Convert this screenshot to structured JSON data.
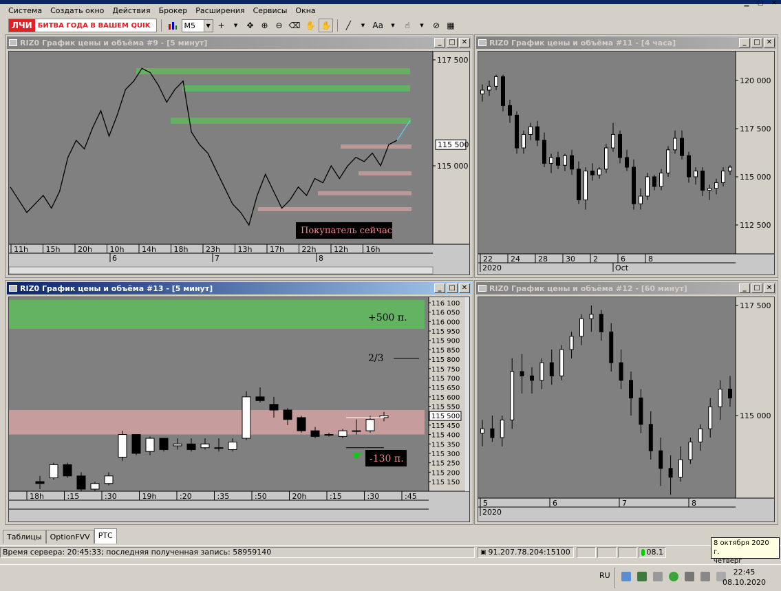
{
  "menu": {
    "items": [
      "Система",
      "Создать окно",
      "Действия",
      "Брокер",
      "Расширения",
      "Сервисы",
      "Окна"
    ]
  },
  "toolbar": {
    "logo_mark": "ЛЧИ",
    "logo_text": "БИТВА ГОДА В ВАШЕМ QUIK",
    "timeframe": "M5",
    "font_label": "Aa"
  },
  "colors": {
    "chart_bg": "#808080",
    "bull": "#ffffff",
    "bear": "#000000",
    "resistance": "#5fb85f",
    "support": "#e6a8a8",
    "active_title": "#0a246a"
  },
  "windows": {
    "w9": {
      "title": "RIZ0 График цены и объёма #9 - [5 минут]"
    },
    "w11": {
      "title": "RIZ0 График цены и объёма #11 - [4 часа]"
    },
    "w13": {
      "title": "RIZ0 График цены и объёма #13 - [5 минут]"
    },
    "w12": {
      "title": "RIZ0 График цены и объёма #12 - [60 минут]"
    }
  },
  "chart_data": [
    {
      "type": "line",
      "id": "w9",
      "series": [
        {
          "values": [
            114500,
            114200,
            113900,
            114100,
            114300,
            114000,
            114400,
            115200,
            115600,
            115400,
            115900,
            116300,
            115700,
            116200,
            116800,
            117000,
            117300,
            117200,
            116900,
            116500,
            116800,
            117000,
            115800,
            115500,
            115300,
            114900,
            114500,
            114100,
            113900,
            113600,
            114300,
            114800,
            114400,
            114000,
            114200,
            114500,
            114300,
            114700,
            114600,
            115000,
            114700,
            115000,
            115200,
            115100,
            115300,
            115000,
            115500,
            115600
          ]
        }
      ],
      "x_ticks": [
        "11h",
        "15h",
        "20h",
        "10h",
        "14h",
        "18h",
        "23h",
        "13h",
        "17h",
        "22h",
        "12h",
        "16h"
      ],
      "date_ticks": [
        "6",
        "7",
        "8"
      ],
      "yticks": [
        "117 500",
        "115 000"
      ],
      "current_price": "115 500",
      "annotation": "Покупатель сейчас"
    },
    {
      "type": "candlestick",
      "id": "w11",
      "ohlc": [
        [
          119300,
          119800,
          118900,
          119500
        ],
        [
          119500,
          120000,
          119200,
          119700
        ],
        [
          119700,
          120300,
          119500,
          120200
        ],
        [
          120200,
          120300,
          118400,
          118700
        ],
        [
          118700,
          119000,
          117800,
          118200
        ],
        [
          118200,
          118400,
          116200,
          116500
        ],
        [
          116500,
          117400,
          116200,
          117200
        ],
        [
          117200,
          117800,
          116900,
          117600
        ],
        [
          117600,
          117900,
          116600,
          116900
        ],
        [
          116900,
          117300,
          115500,
          115700
        ],
        [
          115700,
          116200,
          115200,
          116000
        ],
        [
          116000,
          116300,
          115400,
          115600
        ],
        [
          115600,
          116200,
          115300,
          116100
        ],
        [
          116100,
          116400,
          115100,
          115400
        ],
        [
          115400,
          115800,
          113600,
          113800
        ],
        [
          113800,
          115500,
          113300,
          115300
        ],
        [
          115300,
          115700,
          114800,
          115100
        ],
        [
          115100,
          115500,
          114900,
          115400
        ],
        [
          115400,
          116700,
          115200,
          116500
        ],
        [
          116500,
          117800,
          116300,
          117200
        ],
        [
          117200,
          117400,
          115700,
          116000
        ],
        [
          116000,
          116400,
          115300,
          115500
        ],
        [
          115500,
          115900,
          113300,
          113600
        ],
        [
          113600,
          114400,
          113300,
          114000
        ],
        [
          114000,
          115200,
          113800,
          115000
        ],
        [
          115000,
          115100,
          114300,
          114500
        ],
        [
          114500,
          115400,
          114300,
          115200
        ],
        [
          115200,
          116600,
          115000,
          116400
        ],
        [
          116400,
          117400,
          116200,
          117000
        ],
        [
          117000,
          117400,
          115900,
          116100
        ],
        [
          116100,
          116300,
          114700,
          115000
        ],
        [
          115000,
          115500,
          114600,
          115300
        ],
        [
          115300,
          115500,
          114000,
          114300
        ],
        [
          114300,
          114600,
          113800,
          114400
        ],
        [
          114400,
          114900,
          114100,
          114700
        ],
        [
          114700,
          115500,
          114500,
          115300
        ],
        [
          115300,
          115600,
          115100,
          115500
        ]
      ],
      "x_ticks": [
        "22",
        "24",
        "28",
        "30",
        "2",
        "6",
        "8"
      ],
      "date_ticks": [
        "2020",
        "Oct"
      ],
      "yticks": [
        "120 000",
        "117 500",
        "115 000",
        "112 500"
      ]
    },
    {
      "type": "candlestick",
      "id": "w13",
      "ohlc": [
        [
          115150,
          115180,
          115110,
          115140
        ],
        [
          115170,
          115250,
          115160,
          115240
        ],
        [
          115240,
          115250,
          115170,
          115180
        ],
        [
          115180,
          115200,
          115100,
          115110
        ],
        [
          115110,
          115150,
          115100,
          115140
        ],
        [
          115140,
          115200,
          115130,
          115180
        ],
        [
          115280,
          115420,
          115260,
          115400
        ],
        [
          115400,
          115400,
          115290,
          115300
        ],
        [
          115310,
          115390,
          115290,
          115380
        ],
        [
          115380,
          115380,
          115310,
          115320
        ],
        [
          115340,
          115380,
          115320,
          115350
        ],
        [
          115350,
          115380,
          115310,
          115320
        ],
        [
          115330,
          115380,
          115320,
          115350
        ],
        [
          115330,
          115380,
          115310,
          115330
        ],
        [
          115320,
          115380,
          115310,
          115360
        ],
        [
          115380,
          115630,
          115370,
          115600
        ],
        [
          115600,
          115650,
          115570,
          115580
        ],
        [
          115560,
          115600,
          115490,
          115530
        ],
        [
          115530,
          115540,
          115450,
          115480
        ],
        [
          115490,
          115500,
          115410,
          115420
        ],
        [
          115420,
          115440,
          115380,
          115390
        ],
        [
          115400,
          115410,
          115390,
          115400
        ],
        [
          115390,
          115430,
          115380,
          115420
        ],
        [
          115420,
          115480,
          115400,
          115420
        ],
        [
          115420,
          115500,
          115410,
          115480
        ],
        [
          115490,
          115520,
          115470,
          115500
        ]
      ],
      "x_ticks": [
        "18h",
        ":15",
        ":30",
        "19h",
        ":20",
        ":35",
        ":50",
        "20h",
        ":15",
        ":30",
        ":45"
      ],
      "yticks": [
        "116 100",
        "116 050",
        "116 000",
        "115 950",
        "115 900",
        "115 850",
        "115 800",
        "115 750",
        "115 700",
        "115 650",
        "115 600",
        "115 550",
        "115 500",
        "115 450",
        "115 400",
        "115 350",
        "115 300",
        "115 250",
        "115 200",
        "115 150"
      ],
      "current_price": "115 500",
      "annotations": [
        "+500 п.",
        "2/3",
        "-130 п."
      ]
    },
    {
      "type": "candlestick",
      "id": "w12",
      "ohlc": [
        [
          114600,
          114900,
          114300,
          114700
        ],
        [
          114700,
          115000,
          114400,
          114500
        ],
        [
          114500,
          115000,
          114300,
          114900
        ],
        [
          114900,
          116300,
          114700,
          116000
        ],
        [
          116000,
          116400,
          115500,
          115900
        ],
        [
          115900,
          116100,
          115500,
          115800
        ],
        [
          115800,
          116300,
          115600,
          116200
        ],
        [
          116200,
          116500,
          115700,
          115900
        ],
        [
          115900,
          116600,
          115800,
          116500
        ],
        [
          116500,
          116900,
          116300,
          116800
        ],
        [
          116800,
          117300,
          116600,
          117200
        ],
        [
          117200,
          117500,
          116900,
          117300
        ],
        [
          117300,
          117400,
          116700,
          116900
        ],
        [
          116900,
          117100,
          116000,
          116200
        ],
        [
          116200,
          116500,
          115600,
          115800
        ],
        [
          115800,
          116000,
          115000,
          115400
        ],
        [
          115400,
          115600,
          114600,
          114800
        ],
        [
          114800,
          115100,
          114000,
          114200
        ],
        [
          114200,
          114500,
          113400,
          113800
        ],
        [
          113800,
          114100,
          113200,
          113600
        ],
        [
          113600,
          114300,
          113500,
          114000
        ],
        [
          114000,
          114500,
          113900,
          114400
        ],
        [
          114400,
          114800,
          114200,
          114700
        ],
        [
          114700,
          115400,
          114500,
          115200
        ],
        [
          115200,
          115800,
          114900,
          115600
        ],
        [
          115600,
          115900,
          115200,
          115400
        ]
      ],
      "x_ticks": [
        "5",
        "6",
        "7",
        "8"
      ],
      "date_ticks": [
        "2020"
      ],
      "yticks": [
        "117 500",
        "115 000"
      ]
    }
  ],
  "tabs": [
    "Таблицы",
    "OptionFVV",
    "РТС"
  ],
  "status": {
    "server": "Время сервера: 20:45:33; последняя полученная запись: 58959140",
    "connection": "91.207.78.204:15100",
    "conn_short": "08.1"
  },
  "tooltip": {
    "date": "8 октября 2020 г.",
    "weekday": "четверг"
  },
  "tray": {
    "lang": "RU",
    "time": "22:45",
    "date": "08.10.2020"
  }
}
